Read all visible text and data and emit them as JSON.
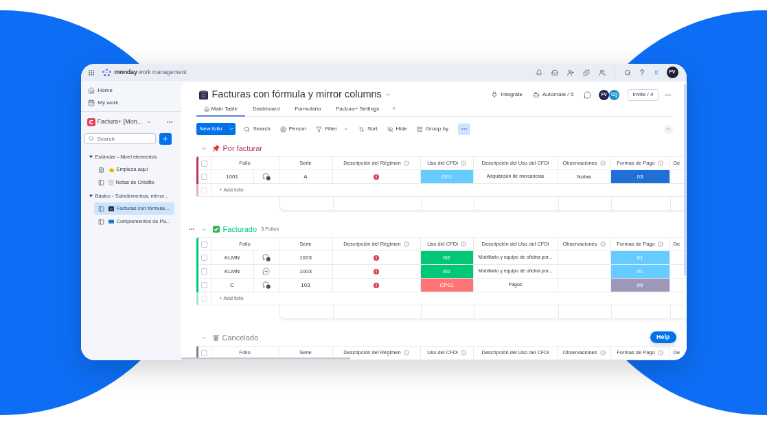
{
  "topbar": {
    "brand": "monday",
    "product": "work management",
    "avatar": "FV"
  },
  "sidebar": {
    "nav": [
      "Home",
      "My work"
    ],
    "workspace": "Factura+ [Mon...",
    "search_placeholder": "Search",
    "tree": [
      {
        "label": "Estándar - Nivel elementos",
        "expanded": true,
        "children": [
          {
            "label": "Empieza aquí",
            "kind": "doc",
            "selected": false
          },
          {
            "label": "Notas de Crédito",
            "kind": "board",
            "selected": false
          }
        ]
      },
      {
        "label": "Básico - Subelementos, mirror...",
        "expanded": true,
        "children": [
          {
            "label": "Facturas con fórmula ...",
            "kind": "board",
            "selected": true
          },
          {
            "label": "Complementos de Pa...",
            "kind": "board",
            "selected": false
          }
        ]
      }
    ]
  },
  "board": {
    "title": "Facturas con fórmula y mirror columns",
    "actions": [
      "Integrate",
      "Automate / 5"
    ],
    "members": [
      {
        "initials": "FV",
        "color": "#22264a"
      },
      {
        "initials": "CQ",
        "color": "#1b8fc6"
      }
    ],
    "invite": "Invite / 4",
    "tabs": [
      {
        "label": "Main Table",
        "selected": true
      },
      {
        "label": "Dashboard",
        "selected": false
      },
      {
        "label": "Formulario",
        "selected": false
      },
      {
        "label": "Factura+ Settings",
        "selected": false
      }
    ],
    "add_tab": "+"
  },
  "toolbar": {
    "primary": "New folio",
    "tools": [
      {
        "label": "Search",
        "dropdown": false
      },
      {
        "label": "Person",
        "dropdown": false
      },
      {
        "label": "Filter",
        "dropdown": true
      },
      {
        "label": "Sort",
        "dropdown": false
      },
      {
        "label": "Hide",
        "dropdown": false
      },
      {
        "label": "Group by",
        "dropdown": false
      }
    ],
    "more_active": true
  },
  "groups": [
    {
      "title": "Por facturar",
      "color": "#bb3354",
      "expanded": true,
      "menu": false,
      "all_selected": false,
      "columns": [
        {
          "label": "Folio",
          "info": false
        },
        {
          "label": "Serie",
          "info": false
        },
        {
          "label": "Descripción del Régimen",
          "info": true
        },
        {
          "label": "Uso del CFDi",
          "info": true
        },
        {
          "label": "Descripción del Uso del CFDi",
          "info": false
        },
        {
          "label": "Observaciones",
          "info": true
        },
        {
          "label": "Formas de Pago",
          "info": true
        },
        {
          "label": "De",
          "info": false
        }
      ],
      "rows": [
        {
          "checked": false,
          "folio": "1001",
          "updates": true,
          "serie": "A",
          "alert": true,
          "uso": {
            "label": "G01",
            "color": "#66ccff"
          },
          "uso_desc": "Adquisición de mercancías",
          "observaciones": "Notas",
          "pago": {
            "label": "03",
            "color": "#1f6fd6"
          }
        }
      ],
      "add_label": "+ Add folio"
    },
    {
      "title": "Facturado",
      "count": "3 Folios",
      "color": "#00c875",
      "expanded": true,
      "menu": true,
      "all_selected": false,
      "columns": [
        {
          "label": "Folio",
          "info": false
        },
        {
          "label": "Serie",
          "info": false
        },
        {
          "label": "Descripción del Régimen",
          "info": true
        },
        {
          "label": "Uso del CFDi",
          "info": true
        },
        {
          "label": "Descripción del Uso del CFDi",
          "info": false
        },
        {
          "label": "Observaciones",
          "info": true
        },
        {
          "label": "Formas de Pago",
          "info": true
        },
        {
          "label": "De",
          "info": false
        }
      ],
      "rows": [
        {
          "checked": false,
          "folio": "KLMN",
          "updates": true,
          "serie": "1003",
          "alert": true,
          "uso": {
            "label": "I02",
            "color": "#00c875"
          },
          "uso_desc": "Mobiliario y equipo de oficina por...",
          "pago": {
            "label": "01",
            "color": "#66ccff"
          }
        },
        {
          "checked": false,
          "folio": "KLMN",
          "updates": false,
          "serie": "1003",
          "alert": true,
          "uso": {
            "label": "I02",
            "color": "#00c875"
          },
          "uso_desc": "Mobiliario y equipo de oficina por...",
          "pago": {
            "label": "01",
            "color": "#66ccff"
          }
        },
        {
          "checked": false,
          "folio": "C",
          "updates": true,
          "serie": "103",
          "alert": true,
          "uso": {
            "label": "CP01",
            "color": "#ff7575"
          },
          "uso_desc": "Pagos",
          "pago": {
            "label": "09",
            "color": "#9d99b9"
          }
        }
      ],
      "add_label": "+ Add folio"
    },
    {
      "title": "Cancelado",
      "color": "#808080",
      "expanded": true,
      "menu": false,
      "all_selected": false,
      "columns": [
        {
          "label": "Folio",
          "info": false
        },
        {
          "label": "Serie",
          "info": false
        },
        {
          "label": "Descripción del Régimen",
          "info": true
        },
        {
          "label": "Uso del CFDi",
          "info": true
        },
        {
          "label": "Descripción del Uso del CFDi",
          "info": false
        },
        {
          "label": "Observaciones",
          "info": true
        },
        {
          "label": "Formas de Pago",
          "info": true
        },
        {
          "label": "De",
          "info": false
        }
      ]
    }
  ],
  "help": "Help"
}
